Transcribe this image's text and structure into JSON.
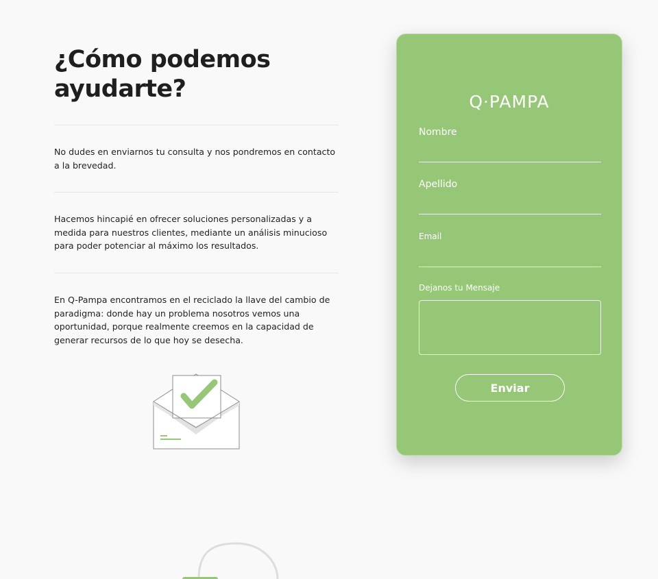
{
  "contact": {
    "title": "¿Cómo podemos ayudarte?",
    "paragraphs": [
      "No dudes en enviarnos tu consulta y nos pondremos en contacto a la brevedad.",
      "Hacemos hincapié en ofrecer soluciones personalizadas y a medida para nuestros clientes, mediante un análisis minucioso para poder potenciar al máximo los resultados.",
      "En Q-Pampa encontramos en el reciclado la llave del cambio de paradigma: donde hay un problema nosotros vemos una oportunidad, porque realmente creemos en la capacidad de generar recursos de lo que hoy se desecha."
    ],
    "illustration_icon": "envelope-check-icon"
  },
  "form": {
    "logo": "Q·PAMPA",
    "fields": {
      "nombre_label": "Nombre",
      "nombre_value": "",
      "apellido_label": "Apellido",
      "apellido_value": "",
      "email_label": "Email",
      "email_value": "",
      "mensaje_label": "Dejanos tu Mensaje",
      "mensaje_value": ""
    },
    "submit_label": "Enviar"
  },
  "colors": {
    "accent": "#95c777",
    "background": "#f9f9f9",
    "text": "#1f1f1f"
  }
}
